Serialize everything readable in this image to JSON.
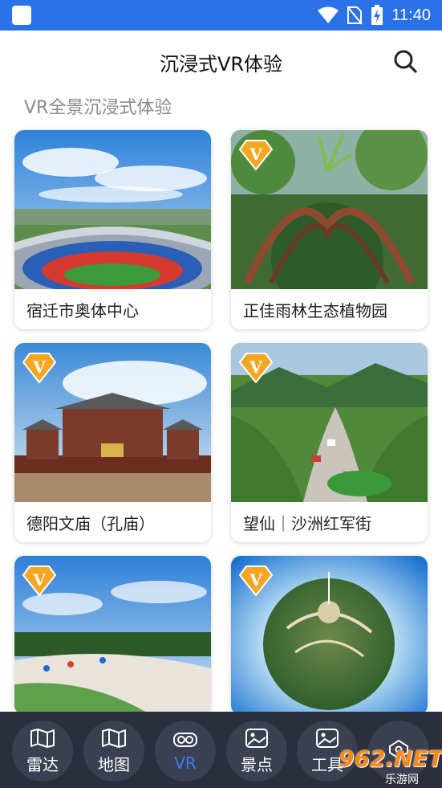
{
  "status_bar": {
    "time": "11:40"
  },
  "header": {
    "title": "沉浸式VR体验"
  },
  "section": {
    "label": "VR全景沉浸式体验"
  },
  "cards": [
    {
      "title": "宿迁市奥体中心",
      "has_vr_badge": false
    },
    {
      "title": "正佳雨林生态植物园",
      "has_vr_badge": true
    },
    {
      "title": "德阳文庙（孔庙）",
      "has_vr_badge": true
    },
    {
      "title": "望仙｜沙洲红军街",
      "has_vr_badge": true
    },
    {
      "title": "",
      "has_vr_badge": true
    },
    {
      "title": "",
      "has_vr_badge": true
    }
  ],
  "vr_badge_letter": "V",
  "bottom_nav": [
    {
      "label": "雷达",
      "icon": "map-fold-icon",
      "active": false
    },
    {
      "label": "地图",
      "icon": "map-fold-icon",
      "active": false
    },
    {
      "label": "VR",
      "icon": "vr-glasses-icon",
      "active": true
    },
    {
      "label": "景点",
      "icon": "photo-icon",
      "active": false
    },
    {
      "label": "工具",
      "icon": "photo-icon",
      "active": false
    },
    {
      "label": "",
      "icon": "pin-icon",
      "active": false
    }
  ],
  "watermark": {
    "brand": "962.NET",
    "sub": "乐游网"
  },
  "colors": {
    "status_bar": "#2b72e8",
    "nav_bg": "#2b2f3d",
    "nav_active": "#3b7df0",
    "badge": "#f5a623"
  }
}
